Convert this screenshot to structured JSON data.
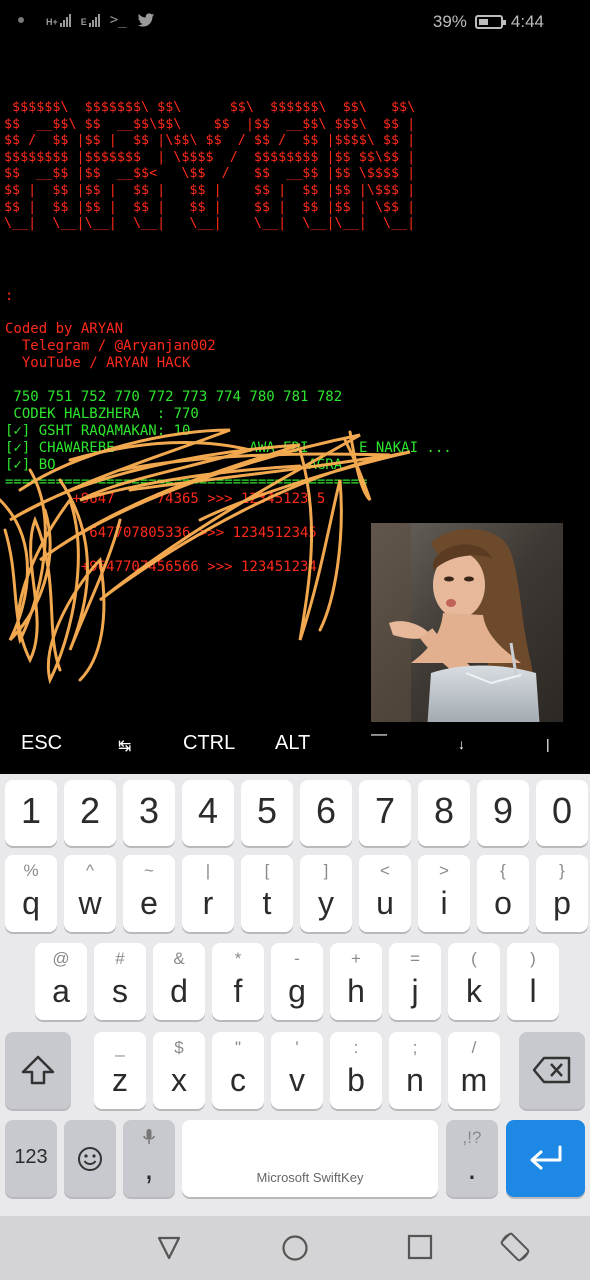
{
  "status_bar": {
    "battery_percent": "39%",
    "time": "4:44",
    "network_1": "H+",
    "network_2": "E",
    "icons": [
      "notification-dot-icon",
      "signal-icon",
      "signal-icon",
      "terminal-icon",
      "twitter-icon",
      "battery-icon"
    ]
  },
  "terminal": {
    "ascii_banner": [
      " $$$$$$\\  $$$$$$$\\ $$\\      $$\\  $$$$$$\\  $$\\   $$\\",
      "$$  __$$\\ $$  __$$\\$$\\    $$  |$$  __$$\\ $$$\\  $$ |",
      "$$ /  $$ |$$ |  $$ |\\$$\\ $$  / $$ /  $$ |$$$$\\ $$ |",
      "$$$$$$$$ |$$$$$$$  | \\$$$$  /  $$$$$$$$ |$$ $$\\$$ |",
      "$$  __$$ |$$  __$$<   \\$$  /   $$  __$$ |$$ \\$$$$ |",
      "$$ |  $$ |$$ |  $$ |   $$ |    $$ |  $$ |$$ |\\$$$ |",
      "$$ |  $$ |$$ |  $$ |   $$ |    $$ |  $$ |$$ | \\$$ |",
      "\\__|  \\__|\\__|  \\__|   \\__|    \\__|  \\__|\\__|  \\__|"
    ],
    "prompt": ":",
    "coded_by": "Coded by ARYAN",
    "telegram": "  Telegram / @Aryanjan002",
    "youtube": "  YouTube / ARYAN HACK",
    "prefixes": " 750 751 752 770 772 773 774 780 781 782",
    "codek": " CODEK HALBZHERA  : 770",
    "line_gsht": "[✓] GSHT RAQAMAKAN: 10",
    "line_chawarebe": "[✓] CHAWAREBE                AWA EDI      E NAKAI ...",
    "line_bo": "[✓] BO                              AGRA",
    "separator": "===========================================",
    "result_1": "        +9647     74365 >>> 12345123 5",
    "result_2": "          647707805336 >>> 1234512345",
    "result_3": "         +9647707456566 >>> 123451234"
  },
  "extra_keys": {
    "esc": "ESC",
    "tab": "↹",
    "ctrl": "CTRL",
    "alt": "ALT",
    "dash": "—",
    "down": "↓",
    "pipe": "|"
  },
  "keyboard": {
    "number_row": [
      "1",
      "2",
      "3",
      "4",
      "5",
      "6",
      "7",
      "8",
      "9",
      "0"
    ],
    "row1": [
      {
        "main": "q",
        "hint": "%"
      },
      {
        "main": "w",
        "hint": "^"
      },
      {
        "main": "e",
        "hint": "~"
      },
      {
        "main": "r",
        "hint": "|"
      },
      {
        "main": "t",
        "hint": "["
      },
      {
        "main": "y",
        "hint": "]"
      },
      {
        "main": "u",
        "hint": "<"
      },
      {
        "main": "i",
        "hint": ">"
      },
      {
        "main": "o",
        "hint": "{"
      },
      {
        "main": "p",
        "hint": "}"
      }
    ],
    "row2": [
      {
        "main": "a",
        "hint": "@"
      },
      {
        "main": "s",
        "hint": "#"
      },
      {
        "main": "d",
        "hint": "&"
      },
      {
        "main": "f",
        "hint": "*"
      },
      {
        "main": "g",
        "hint": "-"
      },
      {
        "main": "h",
        "hint": "+"
      },
      {
        "main": "j",
        "hint": "="
      },
      {
        "main": "k",
        "hint": "("
      },
      {
        "main": "l",
        "hint": ")"
      }
    ],
    "row3": [
      {
        "main": "z",
        "hint": "_"
      },
      {
        "main": "x",
        "hint": "$"
      },
      {
        "main": "c",
        "hint": "\""
      },
      {
        "main": "v",
        "hint": "'"
      },
      {
        "main": "b",
        "hint": ":"
      },
      {
        "main": "n",
        "hint": ";"
      },
      {
        "main": "m",
        "hint": "/"
      }
    ],
    "symbols_key": "123",
    "spacebar_label": "Microsoft SwiftKey",
    "comma": ",",
    "period": ".",
    "period_hint": ",!?",
    "accent_color": "#1e88e5"
  },
  "nav_bar": {
    "icons": [
      "back-triangle-icon",
      "home-circle-icon",
      "recents-square-icon",
      "rotate-icon"
    ]
  }
}
